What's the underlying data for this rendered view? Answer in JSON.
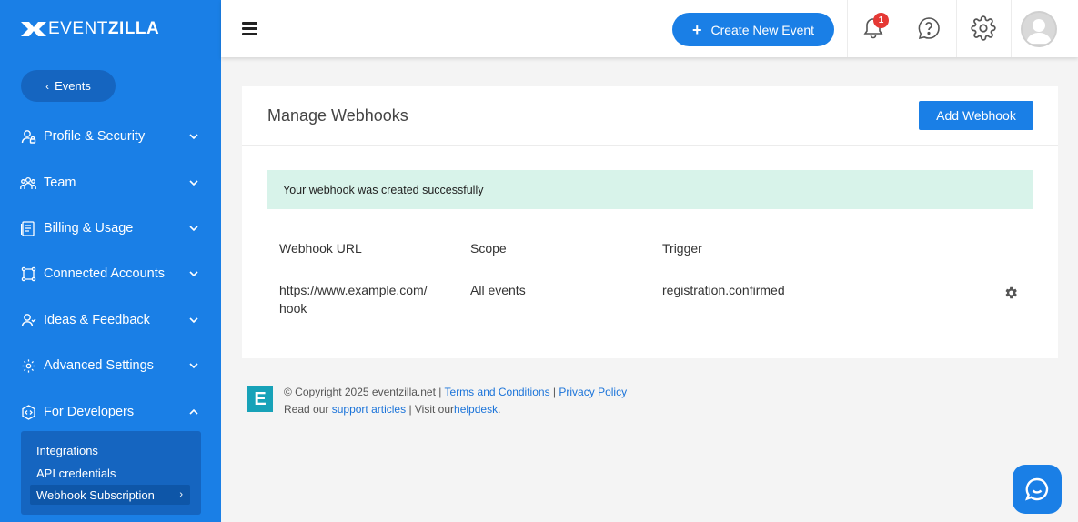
{
  "brand": {
    "name_light": "EVENT",
    "name_bold": "ZILLA"
  },
  "sidebar": {
    "back_label": "Events",
    "items": [
      {
        "label": "Profile & Security",
        "icon": "user-lock-icon"
      },
      {
        "label": "Team",
        "icon": "team-icon"
      },
      {
        "label": "Billing & Usage",
        "icon": "billing-icon"
      },
      {
        "label": "Connected Accounts",
        "icon": "connected-accounts-icon"
      },
      {
        "label": "Ideas & Feedback",
        "icon": "feedback-icon"
      },
      {
        "label": "Advanced Settings",
        "icon": "advanced-settings-icon"
      },
      {
        "label": "For Developers",
        "icon": "developers-icon"
      }
    ],
    "developer_submenu": [
      {
        "label": "Integrations"
      },
      {
        "label": "API credentials"
      },
      {
        "label": "Webhook Subscription"
      }
    ]
  },
  "header": {
    "create_label": "Create New Event",
    "notification_count": "1"
  },
  "main": {
    "title": "Manage Webhooks",
    "add_label": "Add Webhook",
    "alert": "Your webhook was created successfully",
    "columns": [
      "Webhook URL",
      "Scope",
      "Trigger"
    ],
    "rows": [
      {
        "url_line1": "https://www.example.com/",
        "url_line2": "hook",
        "scope": "All events",
        "trigger": "registration.confirmed"
      }
    ]
  },
  "footer": {
    "copyright": "© Copyright 2025 eventzilla.net |",
    "terms": "Terms and Conditions",
    "sep": "|",
    "privacy": "Privacy Policy",
    "read_our": "Read our",
    "support": "support articles",
    "visit": "| Visit our",
    "helpdesk": "helpdesk",
    "period": ".",
    "logo_letter": "E"
  },
  "colors": {
    "primary": "#1a7fe6",
    "sidebar": "#1a7fe6",
    "alert_bg": "#d8f3ea",
    "badge": "#e53935"
  }
}
